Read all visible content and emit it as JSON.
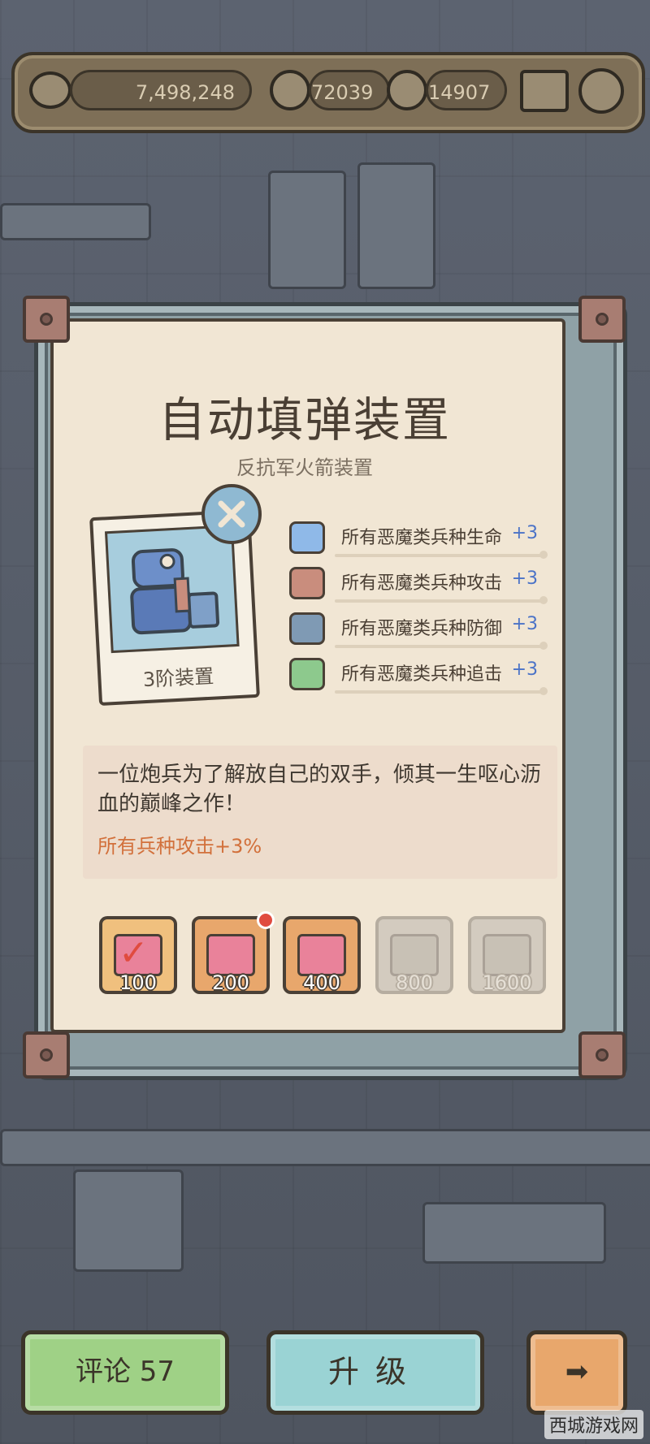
{
  "currency": {
    "eye_value": "7,498,248",
    "bubble1_value": "72039",
    "bubble2_value": "14907"
  },
  "item": {
    "title": "自动填弹装置",
    "subtitle": "反抗军火箭装置",
    "tier_label": "3阶装置"
  },
  "stats": [
    {
      "label": "所有恶魔类兵种生命",
      "value": "+3",
      "color": "#8fb9e8"
    },
    {
      "label": "所有恶魔类兵种攻击",
      "value": "+3",
      "color": "#c98d7d"
    },
    {
      "label": "所有恶魔类兵种防御",
      "value": "+3",
      "color": "#7f9ab4"
    },
    {
      "label": "所有恶魔类兵种追击",
      "value": "+3",
      "color": "#8dc98d"
    }
  ],
  "description": {
    "text": "一位炮兵为了解放自己的双手，倾其一生呕心沥血的巅峰之作！",
    "bonus": "所有兵种攻击+3%"
  },
  "rewards": [
    {
      "label": "100",
      "state": "claimed"
    },
    {
      "label": "200",
      "state": "active"
    },
    {
      "label": "400",
      "state": "active"
    },
    {
      "label": "800",
      "state": "locked"
    },
    {
      "label": "1600",
      "state": "locked"
    }
  ],
  "buttons": {
    "comments": "评论 57",
    "upgrade": "升级"
  },
  "watermark": "西城游戏网"
}
